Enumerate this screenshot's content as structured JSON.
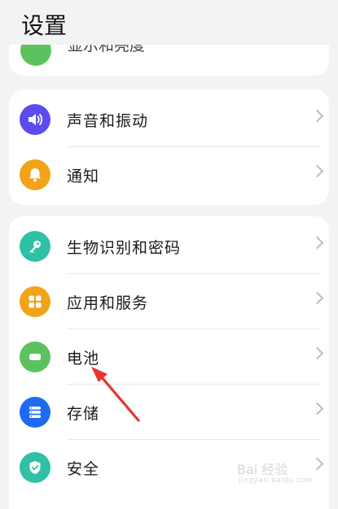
{
  "header": {
    "title": "设置"
  },
  "cut_item": {
    "label": "显示和亮度",
    "icon": "display-icon",
    "color": "#5cc25e"
  },
  "group1": [
    {
      "label": "声音和振动",
      "icon": "speaker-icon",
      "color": "#5b4cf0"
    },
    {
      "label": "通知",
      "icon": "bell-icon",
      "color": "#f2a317"
    }
  ],
  "group2": [
    {
      "label": "生物识别和密码",
      "icon": "key-icon",
      "color": "#2fc0a5"
    },
    {
      "label": "应用和服务",
      "icon": "apps-grid-icon",
      "color": "#f2a317"
    },
    {
      "label": "电池",
      "icon": "battery-icon",
      "color": "#5cc25e"
    },
    {
      "label": "存储",
      "icon": "storage-icon",
      "color": "#1f6bf0"
    },
    {
      "label": "安全",
      "icon": "shield-check-icon",
      "color": "#2fc0a5"
    }
  ],
  "watermark": {
    "text": "Bai 经验",
    "sub": "jingyan.baidu.com"
  },
  "annotation": {
    "color": "#e8342f"
  }
}
